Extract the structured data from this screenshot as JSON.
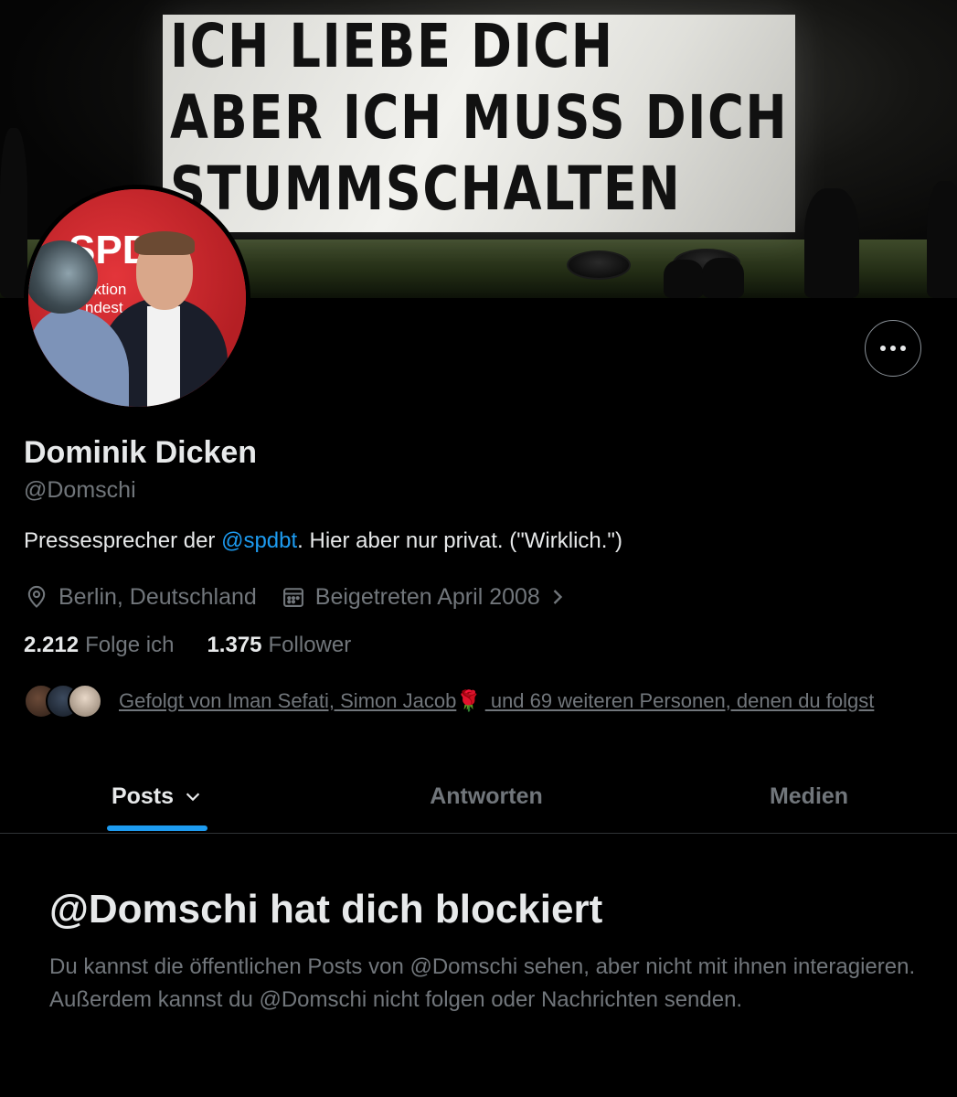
{
  "banner": {
    "lines": [
      "ICH LIEBE DICH",
      "ABER ICH MUSS DICH",
      "STUMMSCHALTEN"
    ]
  },
  "avatar": {
    "logo_text": "SPD",
    "sub_text_1": "aktion",
    "sub_text_2": "ndest"
  },
  "profile": {
    "name": "Dominik Dicken",
    "handle": "@Domschi",
    "bio_before": "Pressesprecher der ",
    "bio_mention": "@spdbt",
    "bio_after": ". Hier aber nur privat. (\"Wirklich.\")",
    "location": "Berlin, Deutschland",
    "joined": "Beigetreten April 2008"
  },
  "counts": {
    "following_value": "2.212",
    "following_label": "Folge ich",
    "followers_value": "1.375",
    "followers_label": "Follower"
  },
  "followed_by": {
    "text_before": "Gefolgt von Iman Sefati, Simon Jacob",
    "emoji": "🌹",
    "text_after": " und 69 weiteren Personen, denen du folgst"
  },
  "tabs": [
    {
      "label": "Posts"
    },
    {
      "label": "Antworten"
    },
    {
      "label": "Medien"
    }
  ],
  "blocked": {
    "title": "@Domschi hat dich blockiert",
    "body": "Du kannst die öffentlichen Posts von @Domschi sehen, aber nicht mit ihnen interagieren. Außerdem kannst du @Domschi nicht folgen oder Nachrichten senden."
  },
  "colors": {
    "background": "#000000",
    "accent": "#1d9bf0",
    "text_primary": "#e7e9ea",
    "text_secondary": "#71767b"
  },
  "icons": {
    "more": "more-horizontal-icon",
    "location": "location-pin-icon",
    "calendar": "calendar-icon",
    "chevron": "chevron-right-icon",
    "tab_dropdown": "chevron-down-icon"
  }
}
